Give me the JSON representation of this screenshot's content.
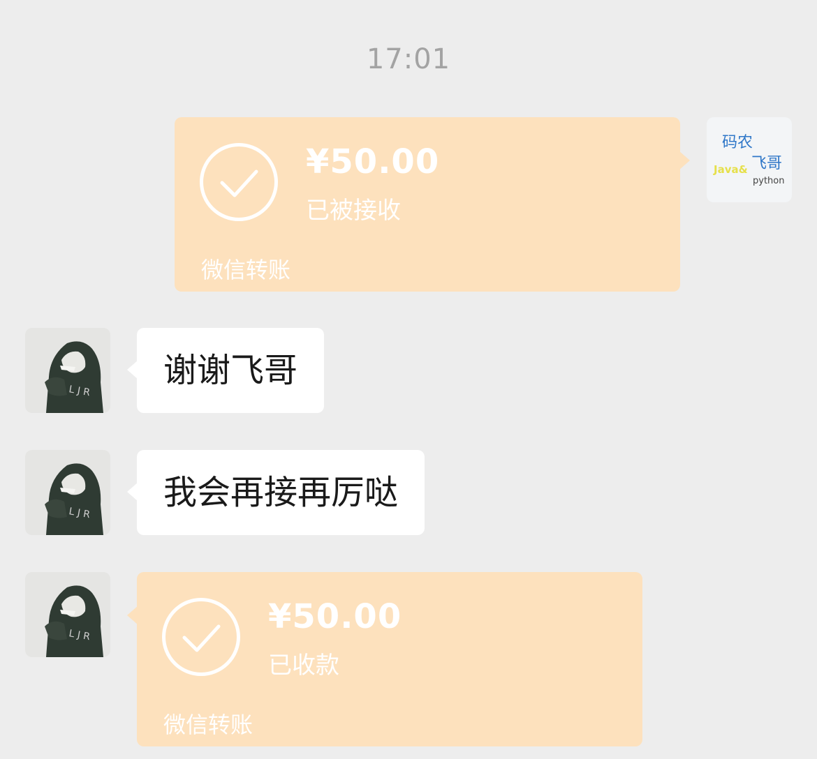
{
  "chat": {
    "timestamp": "17:01",
    "messages": [
      {
        "kind": "transfer",
        "side": "right",
        "amount": "¥50.00",
        "status": "已被接收",
        "footer": "微信转账"
      },
      {
        "kind": "text",
        "side": "left",
        "text": "谢谢飞哥"
      },
      {
        "kind": "text",
        "side": "left",
        "text": "我会再接再厉哒"
      },
      {
        "kind": "transfer",
        "side": "left",
        "amount": "¥50.00",
        "status": "已收款",
        "footer": "微信转账"
      }
    ]
  },
  "self_avatar": {
    "line1": "码农",
    "line2": "飞哥",
    "line3": "Java&",
    "line4": "python"
  },
  "colors": {
    "background": "#ededed",
    "transfer_card": "#fde1bd",
    "text_bubble": "#ffffff",
    "timestamp": "#a3a3a3"
  },
  "icons": {
    "transfer_accepted": "check-circle-icon",
    "contact_avatar": "hooded-person-avatar"
  }
}
